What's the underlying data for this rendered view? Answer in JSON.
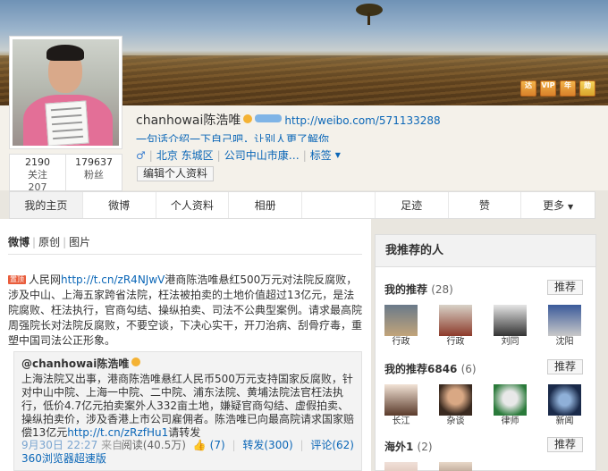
{
  "profile": {
    "name": "chanhowai陈浩唯",
    "url": "http://weibo.com/571133288",
    "intro": "一句话介绍一下自己吧，让别人更了解你",
    "location": "北京 东城区",
    "company": "公司中山市康…",
    "tags_label": "标签",
    "edit_label": "编辑个人资料",
    "stats": [
      {
        "num": "2190",
        "label": "关注"
      },
      {
        "num": "179637",
        "label": "粉丝"
      },
      {
        "num": "207",
        "label": ""
      }
    ],
    "badges": [
      "达",
      "VIP",
      "年",
      "勋"
    ]
  },
  "nav": {
    "tabs": [
      "我的主页",
      "微博",
      "个人资料",
      "相册",
      "",
      "足迹",
      "赞",
      "更多"
    ]
  },
  "feed": {
    "filters": [
      "微博",
      "原创",
      "图片"
    ],
    "post": {
      "top_tag": "置顶",
      "text_before": "人民网",
      "link": "http://t.cn/zR4NJwV",
      "text_after": "港商陈浩唯悬红500万元对法院反腐败，涉及中山、上海五家跨省法院，枉法被拍卖的土地价值超过13亿元，是法院腐败、枉法执行，官商勾结、操纵拍卖、司法不公典型案例。请求最高院周强院长对法院反腐败，不要空谈，下决心实干，开刀治病、刮骨疗毒，重塑中国司法公正形象。"
    },
    "repost": {
      "author": "@chanhowai陈浩唯",
      "text": "上海法院又出事，港商陈浩唯悬红人民币500万元支持国家反腐败，针对中山中院、上海一中院、二中院、浦东法院、黄埔法院法官枉法执行，低价4.7亿元拍卖案外人332亩土地，嫌疑官商勾结、虚假拍卖、操纵拍卖价，涉及香港上市公司雇佣者。陈浩唯已向最高院请求国家赔偿13亿元",
      "link": "http://t.cn/zRzfHu1",
      "text_end": "请转发",
      "time": "9月30日 22:27",
      "source_prefix": "来自",
      "source": "360浏览器超速版",
      "read": "阅读(40.5万)",
      "likes": "(7)",
      "forward": "转发(300)",
      "comments": "评论(62)"
    }
  },
  "sidebar": {
    "title": "我推荐的人",
    "groups": [
      {
        "title": "我的推荐",
        "count": "(28)",
        "button": "推荐",
        "people": [
          "行政",
          "行政",
          "刘同",
          "沈阳"
        ]
      },
      {
        "title": "我的推荐6846",
        "count": "(6)",
        "button": "推荐",
        "people": [
          "长江",
          "杂谈",
          "律师",
          "新闻"
        ]
      },
      {
        "title": "海外1",
        "count": "(2)",
        "button": "推荐",
        "people": []
      }
    ]
  },
  "colors": {
    "link": "#0a66b7",
    "accent": "#e95c3b",
    "badge": "#f3b44a"
  }
}
